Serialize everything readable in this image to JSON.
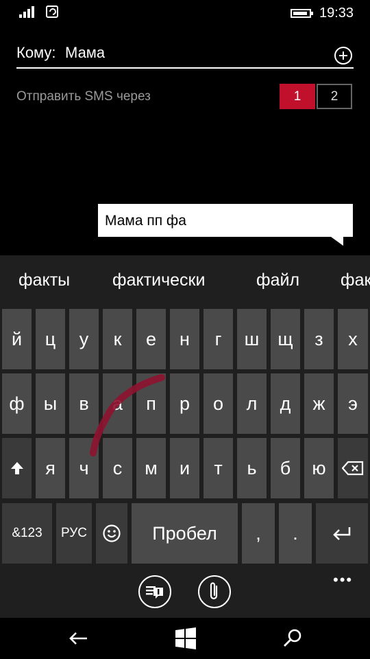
{
  "status_bar": {
    "time": "19:33",
    "signal_icon": "signal-bars-icon",
    "sync_icon": "sync-icon",
    "battery_icon": "battery-icon"
  },
  "compose": {
    "to_label": "Кому:",
    "to_value": "Мама",
    "add_contact_icon": "add-circle-icon",
    "send_via_label": "Отправить SMS через",
    "sim_options": [
      "1",
      "2"
    ],
    "selected_sim": "1",
    "accent_color": "#c0102c"
  },
  "message": {
    "text": "Мама пп фа"
  },
  "keyboard": {
    "suggestions": [
      "факты",
      "фактически",
      "файл",
      "фак"
    ],
    "row1": [
      "й",
      "ц",
      "у",
      "к",
      "е",
      "н",
      "г",
      "ш",
      "щ",
      "з",
      "х"
    ],
    "row2": [
      "ф",
      "ы",
      "в",
      "а",
      "п",
      "р",
      "о",
      "л",
      "д",
      "ж",
      "э"
    ],
    "row3": [
      "я",
      "ч",
      "с",
      "м",
      "и",
      "т",
      "ь",
      "б",
      "ю"
    ],
    "shift_icon": "shift-arrow-icon",
    "backspace_icon": "backspace-icon",
    "numbers_label": "&123",
    "language_label": "РУС",
    "emoji_icon": "emoji-icon",
    "space_label": "Пробел",
    "comma_label": ",",
    "period_label": ".",
    "enter_icon": "enter-icon"
  },
  "app_bar": {
    "sim_switch_icon": "sim-message-icon",
    "attach_icon": "paperclip-icon",
    "more_label": "•••"
  },
  "nav_bar": {
    "back_icon": "back-arrow-icon",
    "start_icon": "windows-logo-icon",
    "search_icon": "search-icon"
  }
}
